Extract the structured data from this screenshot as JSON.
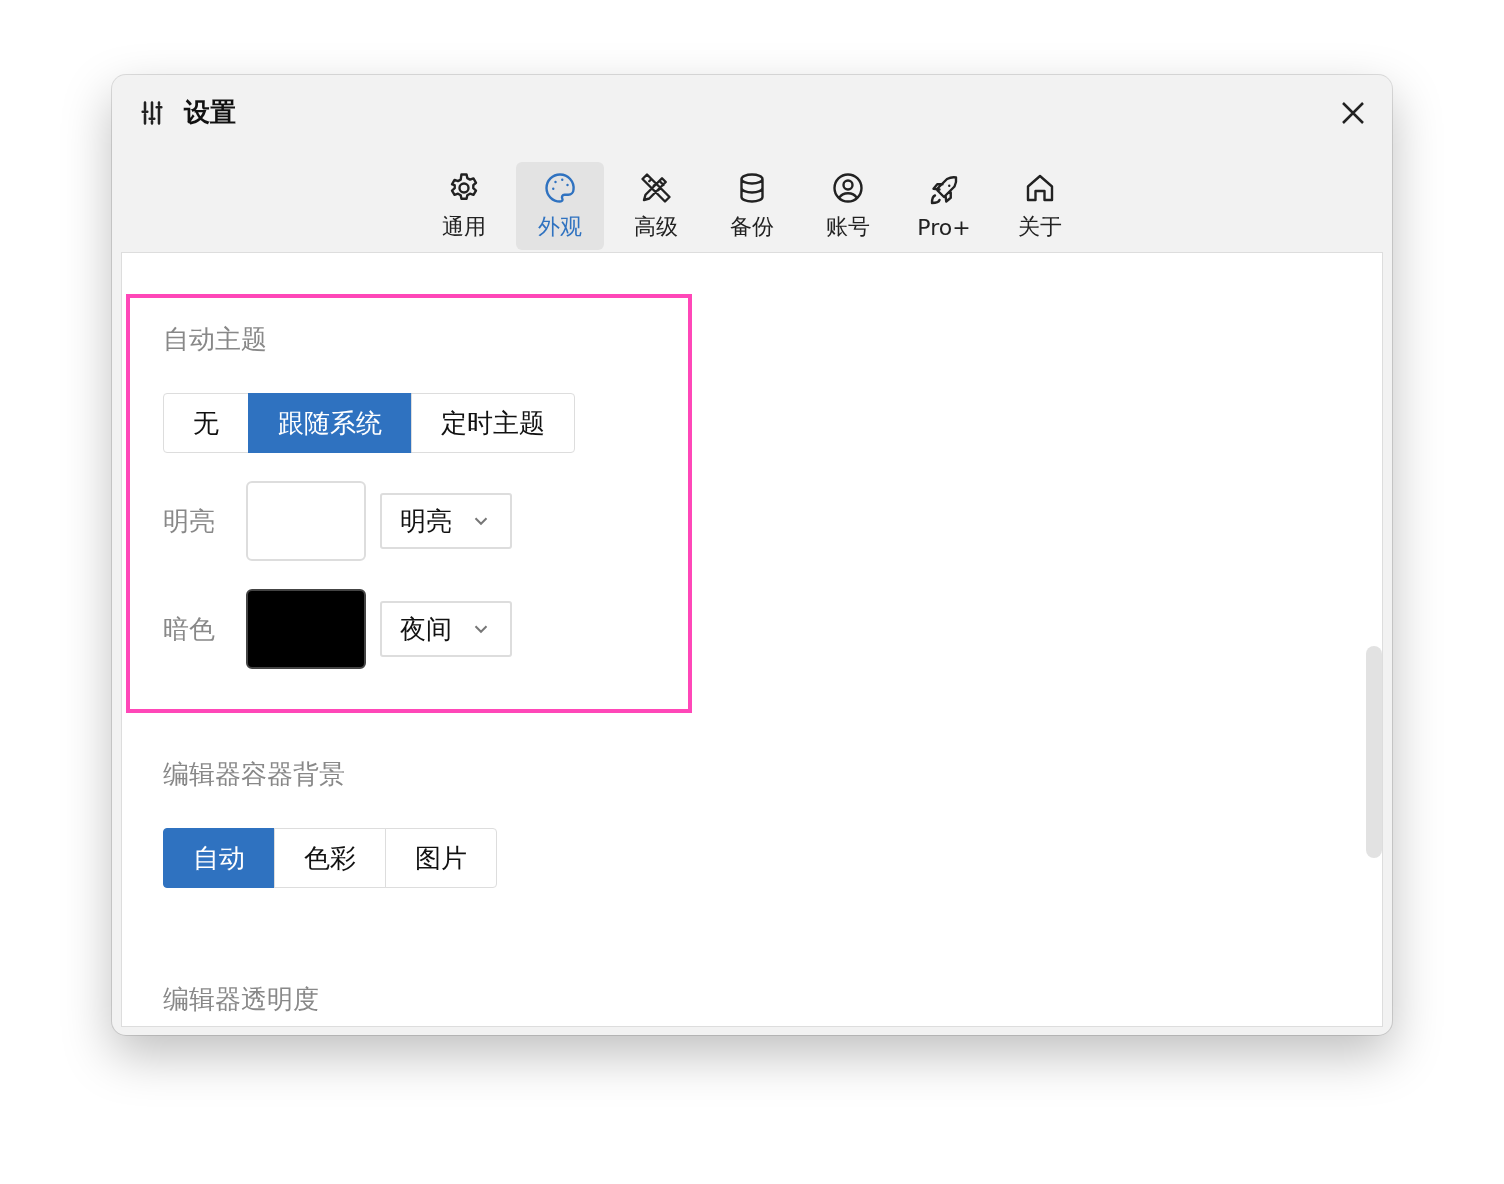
{
  "window": {
    "title": "设置"
  },
  "tabs": [
    {
      "label": "通用",
      "selected": false
    },
    {
      "label": "外观",
      "selected": true
    },
    {
      "label": "高级",
      "selected": false
    },
    {
      "label": "备份",
      "selected": false
    },
    {
      "label": "账号",
      "selected": false
    },
    {
      "label": "Pro+",
      "selected": false
    },
    {
      "label": "关于",
      "selected": false
    }
  ],
  "auto_theme": {
    "title": "自动主题",
    "options": [
      {
        "label": "无",
        "selected": false
      },
      {
        "label": "跟随系统",
        "selected": true
      },
      {
        "label": "定时主题",
        "selected": false
      }
    ],
    "rows": [
      {
        "label": "明亮",
        "color": "#ffffff",
        "value": "明亮"
      },
      {
        "label": "暗色",
        "color": "#000000",
        "value": "夜间"
      }
    ]
  },
  "editor_background": {
    "title": "编辑器容器背景",
    "options": [
      {
        "label": "自动",
        "selected": true
      },
      {
        "label": "色彩",
        "selected": false
      },
      {
        "label": "图片",
        "selected": false
      }
    ]
  },
  "editor_opacity": {
    "title": "编辑器透明度"
  }
}
